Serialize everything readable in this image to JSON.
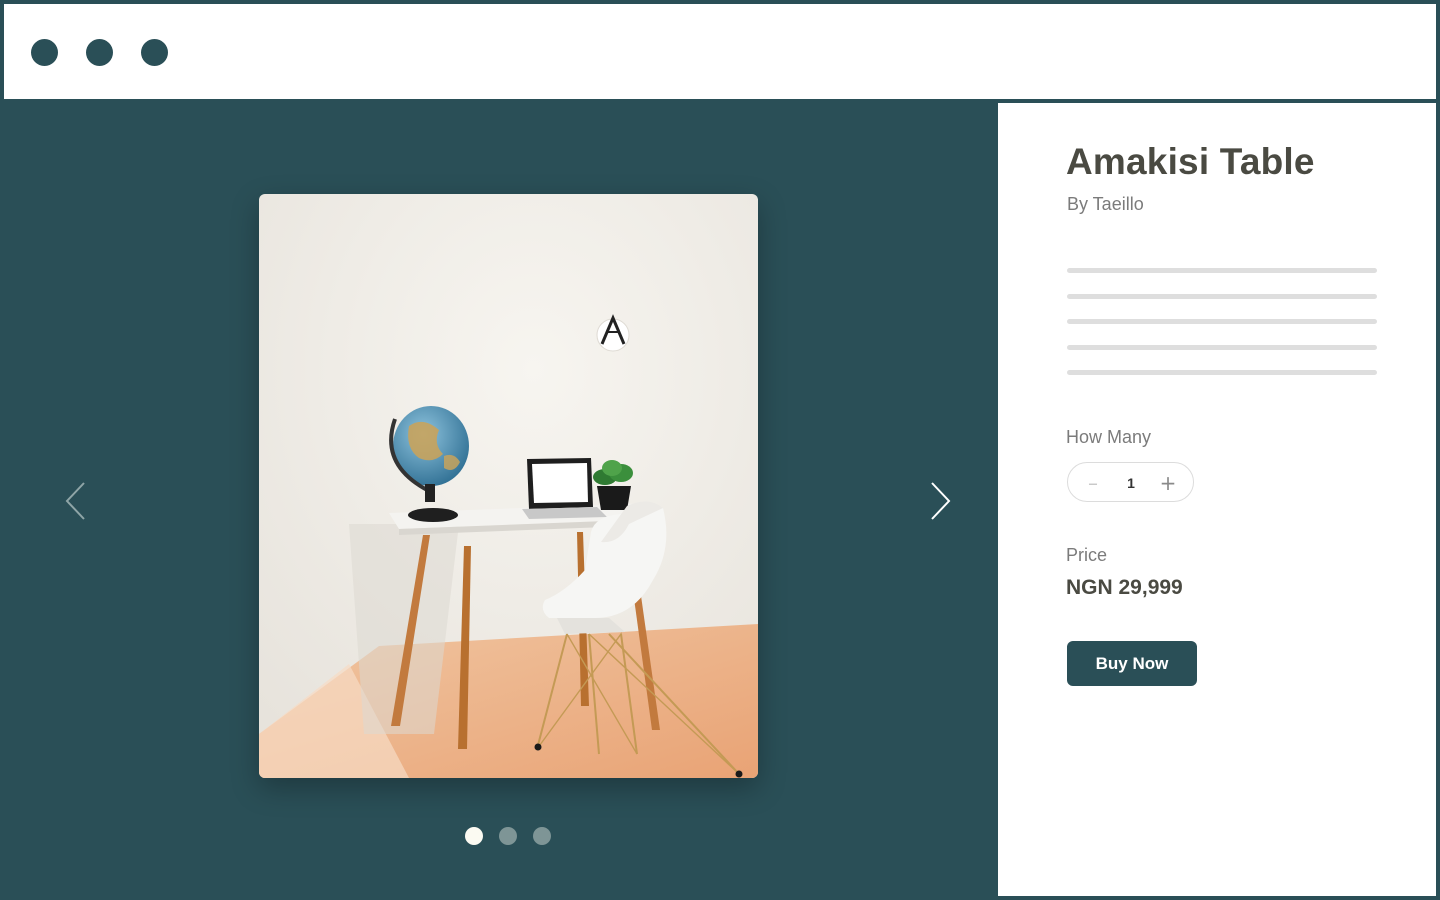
{
  "window": {
    "controls": [
      "window-dot",
      "window-dot",
      "window-dot"
    ],
    "accent_color": "#2a4f57"
  },
  "gallery": {
    "background_color": "#2a4f57",
    "image_icon": "desk-with-globe-laptop-chair-photo",
    "prev_icon": "chevron-left-icon",
    "next_icon": "chevron-right-icon",
    "total_slides": 3,
    "active_slide": 1
  },
  "product": {
    "title": "Amakisi Table",
    "byline": "By Taeillo",
    "description_placeholder_lines": 5,
    "quantity_label": "How Many",
    "quantity": "1",
    "decrement_icon": "minus-icon",
    "increment_icon": "plus-icon",
    "price_label": "Price",
    "price": "NGN 29,999",
    "buy_label": "Buy Now"
  }
}
